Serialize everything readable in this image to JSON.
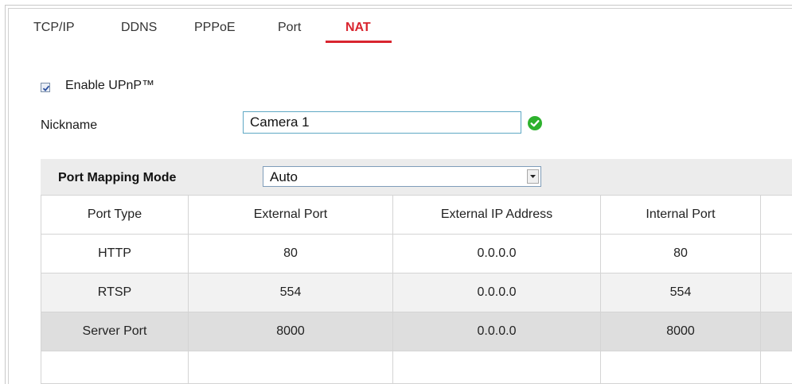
{
  "tabs": [
    {
      "label": "TCP/IP",
      "active": false
    },
    {
      "label": "DDNS",
      "active": false
    },
    {
      "label": "PPPoE",
      "active": false
    },
    {
      "label": "Port",
      "active": false
    },
    {
      "label": "NAT",
      "active": true
    }
  ],
  "upnp": {
    "label": "Enable UPnP™",
    "checked": true
  },
  "nickname": {
    "label": "Nickname",
    "value": "Camera 1",
    "status_icon": "check-circle-icon",
    "status_color": "#2db12d"
  },
  "port_mapping": {
    "label": "Port Mapping Mode",
    "selected": "Auto",
    "dropdown_icon": "chevron-down-icon"
  },
  "table": {
    "columns": [
      "Port Type",
      "External Port",
      "External IP Address",
      "Internal Port",
      ""
    ],
    "rows": [
      {
        "cells": [
          "HTTP",
          "80",
          "0.0.0.0",
          "80",
          ""
        ],
        "style": "normal"
      },
      {
        "cells": [
          "RTSP",
          "554",
          "0.0.0.0",
          "554",
          ""
        ],
        "style": "alt"
      },
      {
        "cells": [
          "Server Port",
          "8000",
          "0.0.0.0",
          "8000",
          ""
        ],
        "style": "selected"
      },
      {
        "cells": [
          "",
          "",
          "",
          "",
          ""
        ],
        "style": "empty"
      }
    ]
  },
  "colors": {
    "accent": "#d9252f",
    "input_border": "#5fa8c4",
    "row_alt": "#f2f2f2",
    "row_selected": "#dedede"
  }
}
